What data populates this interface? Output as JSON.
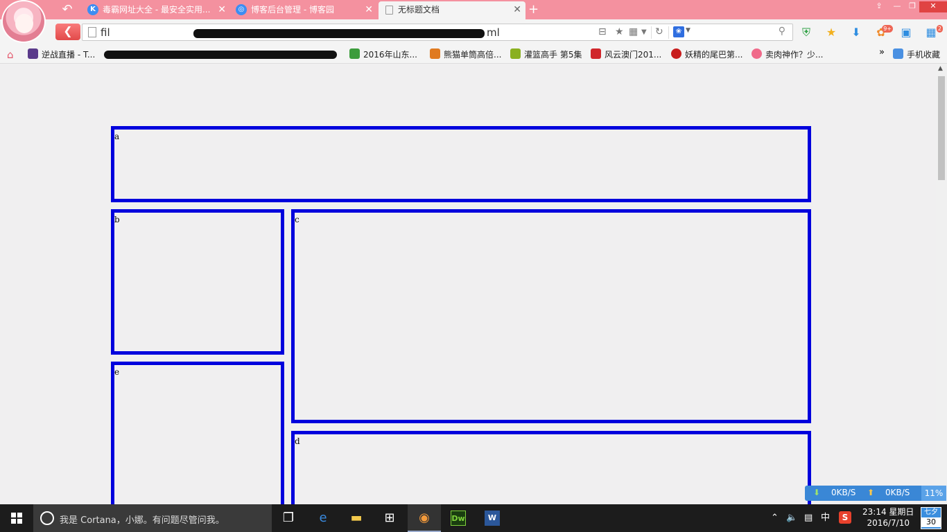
{
  "browser": {
    "tabs": [
      {
        "label": "毒霸网址大全 - 最安全实用...",
        "icon": "k-icon"
      },
      {
        "label": "博客后台管理 - 博客园",
        "icon": "cnblogs-icon"
      },
      {
        "label": "无标题文档",
        "icon": "document-icon",
        "active": true
      }
    ],
    "new_tab_symbol": "+",
    "window_controls": [
      "⇪",
      "—",
      "❐",
      "✕"
    ],
    "url_prefix": "fil",
    "url_suffix": "ml",
    "search_placeholder": ""
  },
  "bookmarks": [
    {
      "label": "逆战直播 - T...",
      "icon_color": "#5a3a8a"
    },
    {
      "label": "2016年山东...",
      "icon_color": "#3c9c3c"
    },
    {
      "label": "熊猫单筒高倍...",
      "icon_color": "#e07a20"
    },
    {
      "label": "灌篮高手 第5集",
      "icon_color": "#8ab020"
    },
    {
      "label": "风云澳门201...",
      "icon_color": "#d0262b"
    },
    {
      "label": "妖精的尾巴第...",
      "icon_color": "#c81e1e"
    },
    {
      "label": "卖肉神作？少...",
      "icon_color": "#f06a8a"
    }
  ],
  "bookmarks_more": "»",
  "mobile_favorites": "手机收藏",
  "page": {
    "boxes": [
      {
        "id": "a",
        "label": "a"
      },
      {
        "id": "b",
        "label": "b"
      },
      {
        "id": "c",
        "label": "c"
      },
      {
        "id": "e",
        "label": "e"
      },
      {
        "id": "d",
        "label": "d"
      }
    ],
    "border_color": "#0000dd"
  },
  "netspeed": {
    "down": "0KB/S",
    "up": "0KB/S",
    "percent": "11%"
  },
  "taskbar": {
    "cortana_text": "我是 Cortana，小娜。有问题尽管问我。",
    "apps": [
      "task-view",
      "edge",
      "file-explorer",
      "store",
      "browser",
      "dreamweaver",
      "word"
    ],
    "dw_label": "Dw",
    "word_label": "W",
    "ime": "中",
    "sogou": "S",
    "time": "23:14 星期日",
    "date": "2016/7/10",
    "calendar_top": "七夕",
    "calendar_day": "30"
  }
}
